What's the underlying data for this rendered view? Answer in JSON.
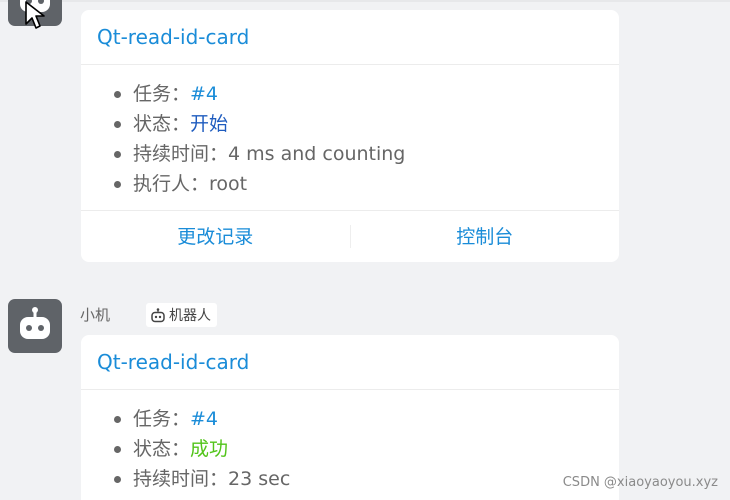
{
  "message1": {
    "card": {
      "title": "Qt-read-id-card",
      "rows": [
        {
          "label": "任务：",
          "value": "#4"
        },
        {
          "label": "状态：",
          "value": "开始"
        },
        {
          "label": "持续时间：",
          "value": "4 ms and counting"
        },
        {
          "label": "执行人：",
          "value": "root"
        }
      ],
      "actions": {
        "changes": "更改记录",
        "console": "控制台"
      }
    }
  },
  "message2": {
    "sender": "小机",
    "badge": "机器人",
    "card": {
      "title": "Qt-read-id-card",
      "rows": [
        {
          "label": "任务：",
          "value": "#4"
        },
        {
          "label": "状态：",
          "value": "成功"
        },
        {
          "label": "持续时间：",
          "value": "23 sec"
        }
      ]
    }
  },
  "watermark": "CSDN @xiaoyaoyou.xyz",
  "colors": {
    "link": "#1a8cd8",
    "status_start": "#1f5cbf",
    "status_success": "#52c41a",
    "avatar": "#5f6368"
  },
  "icons": {
    "avatar": "robot-icon",
    "badge": "robot-icon",
    "cursor": "mouse-pointer-icon"
  }
}
